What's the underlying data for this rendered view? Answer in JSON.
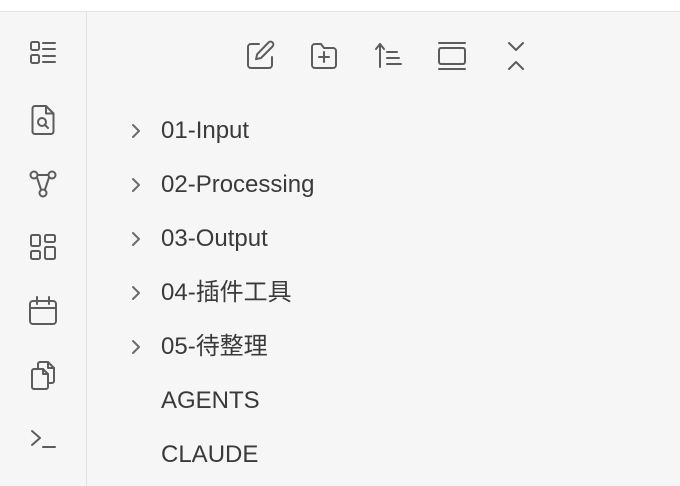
{
  "ribbon": {
    "items": [
      {
        "icon": "list-layout-icon"
      },
      {
        "icon": "file-search-icon"
      },
      {
        "icon": "graph-icon"
      },
      {
        "icon": "dashboard-grid-icon"
      },
      {
        "icon": "calendar-icon"
      },
      {
        "icon": "copy-files-icon"
      },
      {
        "icon": "terminal-icon"
      }
    ]
  },
  "nav_header": {
    "buttons": [
      {
        "icon": "new-note-icon"
      },
      {
        "icon": "new-folder-icon"
      },
      {
        "icon": "sort-order-icon"
      },
      {
        "icon": "auto-reveal-icon"
      },
      {
        "icon": "collapse-all-icon"
      }
    ]
  },
  "tree": {
    "items": [
      {
        "label": "01-Input",
        "type": "folder"
      },
      {
        "label": "02-Processing",
        "type": "folder"
      },
      {
        "label": "03-Output",
        "type": "folder"
      },
      {
        "label": "04-插件工具",
        "type": "folder"
      },
      {
        "label": "05-待整理",
        "type": "folder"
      },
      {
        "label": "AGENTS",
        "type": "file"
      },
      {
        "label": "CLAUDE",
        "type": "file"
      }
    ]
  },
  "colors": {
    "background": "#f6f6f6",
    "text": "#3a3a3a",
    "icon": "#5c5c5c",
    "border": "#e2e2e2"
  }
}
